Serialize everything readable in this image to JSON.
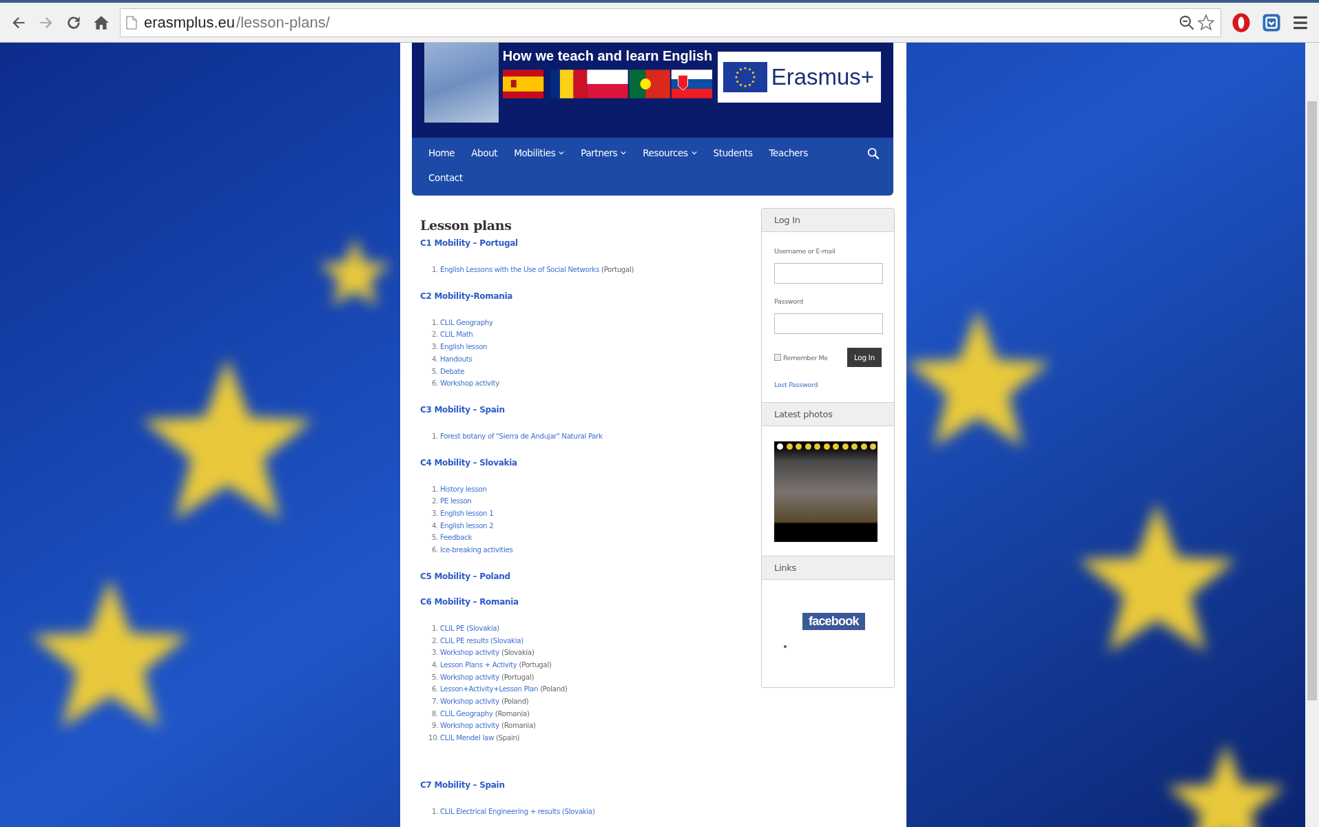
{
  "browser": {
    "url_host": "erasmplus.eu",
    "url_path": "/lesson-plans/"
  },
  "header": {
    "tagline": "How we teach and learn English",
    "logo_text": "Erasmus+"
  },
  "nav": [
    {
      "label": "Home",
      "has_submenu": false
    },
    {
      "label": "About",
      "has_submenu": false
    },
    {
      "label": "Mobilities",
      "has_submenu": true
    },
    {
      "label": "Partners",
      "has_submenu": true
    },
    {
      "label": "Resources",
      "has_submenu": true
    },
    {
      "label": "Students",
      "has_submenu": false
    },
    {
      "label": "Teachers",
      "has_submenu": false
    },
    {
      "label": "Contact",
      "has_submenu": false
    }
  ],
  "page": {
    "title": "Lesson plans",
    "sections": [
      {
        "heading": "C1 Mobility – Portugal",
        "items": [
          {
            "number": "1.",
            "link": "English Lessons with the Use of Social Networks",
            "note": "(Portugal)"
          }
        ]
      },
      {
        "heading": "C2 Mobility-Romania",
        "items": [
          {
            "number": "1.",
            "link": "CLIL Geography"
          },
          {
            "number": "2.",
            "link": "CLIL Math"
          },
          {
            "number": "3.",
            "link": "English lesson"
          },
          {
            "number": "4.",
            "link": "Handouts"
          },
          {
            "number": "5.",
            "link": "Debate"
          },
          {
            "number": "6.",
            "link": "Workshop activity"
          }
        ]
      },
      {
        "heading": "C3 Mobility – Spain",
        "items": [
          {
            "number": "1.",
            "link": "Forest botany of \"Sierra de Andujar\" Natural Park"
          }
        ]
      },
      {
        "heading": "C4 Mobility – Slovakia",
        "items": [
          {
            "number": "1.",
            "link": "History lesson"
          },
          {
            "number": "2.",
            "link": "PE lesson"
          },
          {
            "number": "3.",
            "link": "English lesson 1"
          },
          {
            "number": "4.",
            "link": "English lesson 2"
          },
          {
            "number": "5.",
            "link": "Feedback"
          },
          {
            "number": "6.",
            "link": "Ice-breaking activities"
          }
        ]
      },
      {
        "heading": "C5 Mobility – Poland"
      },
      {
        "heading": "C6 Mobility – Romania",
        "items": [
          {
            "number": "1.",
            "link": "CLIL PE (Slovakia)"
          },
          {
            "number": "2.",
            "link": "CLIL PE results (Slovakia)"
          },
          {
            "number": "3.",
            "link": "Workshop activity",
            "note": "(Slovakia)"
          },
          {
            "number": "4.",
            "link": "Lesson Plans + Activity",
            "note": "(Portugal)"
          },
          {
            "number": "5.",
            "link": "Workshop activity",
            "note": "(Portugal)"
          },
          {
            "number": "6.",
            "link": "Lesson+Activity+Lesson Plan",
            "note": "(Poland)"
          },
          {
            "number": "7.",
            "link": "Workshop activity",
            "note": "(Poland)"
          },
          {
            "number": "8.",
            "link": "CLIL Geography",
            "note": "(Romania)"
          },
          {
            "number": "9.",
            "link": "Workshop activity",
            "note": "(Romania)"
          },
          {
            "number": "10.",
            "link": "CLIL Mendel law",
            "note": "(Spain)"
          }
        ]
      },
      {
        "heading": "C7 Mobility – Spain",
        "items": [
          {
            "number": "1.",
            "link": "CLIL Electrical Engineering + results (Slovakia)"
          }
        ]
      }
    ]
  },
  "sidebar": {
    "login": {
      "title": "Log In",
      "username_label": "Username or E-mail",
      "password_label": "Password",
      "remember_label": "Remember Me",
      "remember_checked": false,
      "button": "Log In",
      "lost_password": "Lost Password"
    },
    "photos": {
      "title": "Latest photos",
      "dots": [
        {
          "selected": true
        },
        {
          "selected": false
        },
        {
          "selected": false
        },
        {
          "selected": false
        },
        {
          "selected": false
        },
        {
          "selected": false
        },
        {
          "selected": false
        },
        {
          "selected": false
        },
        {
          "selected": false
        },
        {
          "selected": false
        },
        {
          "selected": false
        }
      ]
    },
    "links": {
      "title": "Links",
      "facebook": "facebook"
    }
  }
}
